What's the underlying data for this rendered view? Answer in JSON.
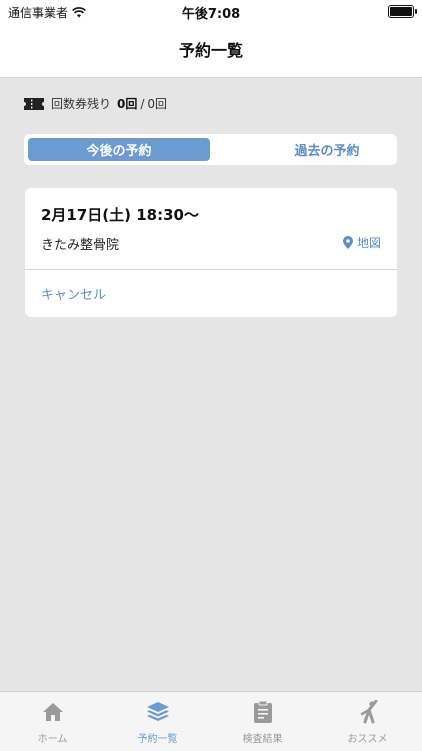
{
  "status_bar": {
    "carrier": "通信事業者",
    "time": "午後7:08"
  },
  "nav": {
    "title": "予約一覧"
  },
  "tickets": {
    "label": "回数券残り",
    "remaining": "0回",
    "separator": "/",
    "total": "0回"
  },
  "segment": {
    "upcoming": "今後の予約",
    "past": "過去の予約",
    "selected": "今後の予約"
  },
  "reservation": {
    "datetime": "2月17日(土) 18:30〜",
    "clinic": "きたみ整骨院",
    "map_label": "地図",
    "cancel_label": "キャンセル"
  },
  "tabs": [
    {
      "label": "ホーム",
      "icon": "home-icon"
    },
    {
      "label": "予約一覧",
      "icon": "layers-icon"
    },
    {
      "label": "検査結果",
      "icon": "clipboard-icon"
    },
    {
      "label": "おススメ",
      "icon": "stretch-figure-icon"
    }
  ],
  "colors": {
    "accent": "#6b9bd1",
    "link": "#5c8cc8",
    "background": "#e5e5e5",
    "inactive_tab": "#9a9a9a"
  }
}
